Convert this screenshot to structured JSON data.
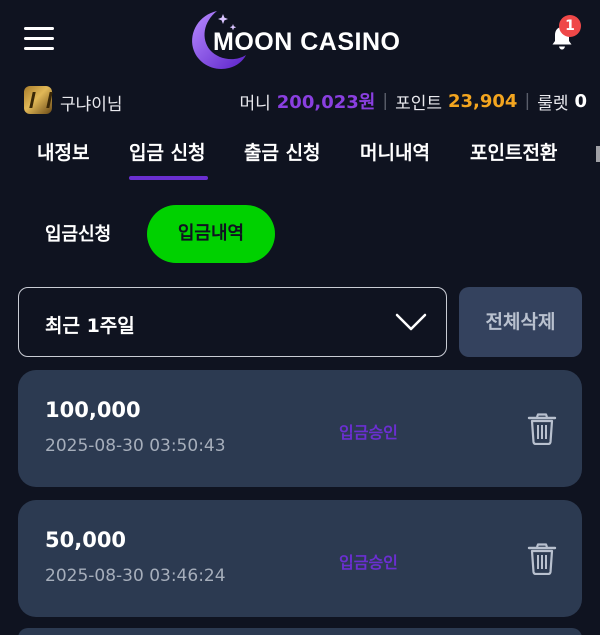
{
  "header": {
    "logo_text": "MOON CASINO",
    "notification_count": "1"
  },
  "user": {
    "name": "구냐이님",
    "money_label": "머니",
    "money_value": "200,023원",
    "point_label": "포인트",
    "point_value": "23,904",
    "roulette_label": "룰렛",
    "roulette_value": "0"
  },
  "tabs": [
    {
      "label": "내정보"
    },
    {
      "label": "입금 신청",
      "active": true
    },
    {
      "label": "출금 신청"
    },
    {
      "label": "머니내역"
    },
    {
      "label": "포인트전환"
    }
  ],
  "subtabs": {
    "request": "입금신청",
    "history": "입금내역"
  },
  "filter": {
    "selected": "최근 1주일",
    "delete_all": "전체삭제"
  },
  "deposits": [
    {
      "amount": "100,000",
      "datetime": "2025-08-30 03:50:43",
      "status": "입금승인"
    },
    {
      "amount": "50,000",
      "datetime": "2025-08-30 03:46:24",
      "status": "입금승인"
    }
  ],
  "colors": {
    "background": "#0f1320",
    "card": "#2c3a51",
    "accent_purple": "#6a2fd0",
    "accent_green": "#00d100",
    "point_orange": "#f3a51f"
  },
  "icons": [
    "hamburger-menu-icon",
    "crescent-moon-logo-icon",
    "bell-icon",
    "chevron-down-icon",
    "trash-icon"
  ]
}
